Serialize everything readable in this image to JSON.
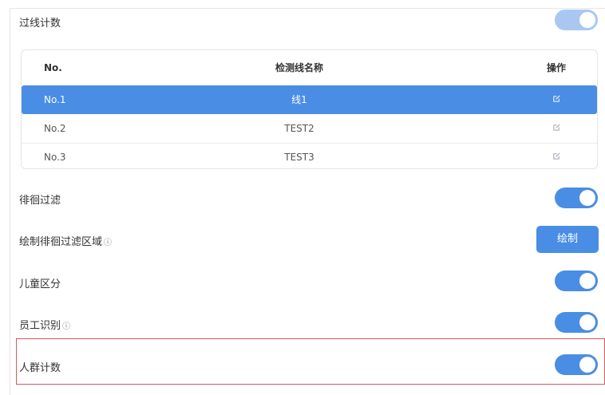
{
  "line_count": {
    "label": "过线计数",
    "toggle_on": true
  },
  "table": {
    "headers": [
      "No.",
      "检测线名称",
      "操作"
    ],
    "rows": [
      {
        "no": "No.1",
        "name": "线1",
        "selected": true,
        "action_icon": "edit-icon"
      },
      {
        "no": "No.2",
        "name": "TEST2",
        "selected": false,
        "action_icon": "edit-icon"
      },
      {
        "no": "No.3",
        "name": "TEST3",
        "selected": false,
        "action_icon": "edit-icon"
      }
    ]
  },
  "loiter_filter": {
    "label": "徘徊过滤",
    "toggle_on": true
  },
  "draw_loiter_area": {
    "label": "绘制徘徊过滤区域",
    "info_icon": "ⓘ",
    "button_label": "绘制"
  },
  "child_distinguish": {
    "label": "儿童区分",
    "toggle_on": true
  },
  "staff_identify": {
    "label": "员工识别",
    "info_icon": "ⓘ",
    "toggle_on": true
  },
  "crowd_count": {
    "label": "人群计数",
    "toggle_on": true
  },
  "colors": {
    "accent": "#4a8de4",
    "highlight_border": "#d65a5a"
  }
}
